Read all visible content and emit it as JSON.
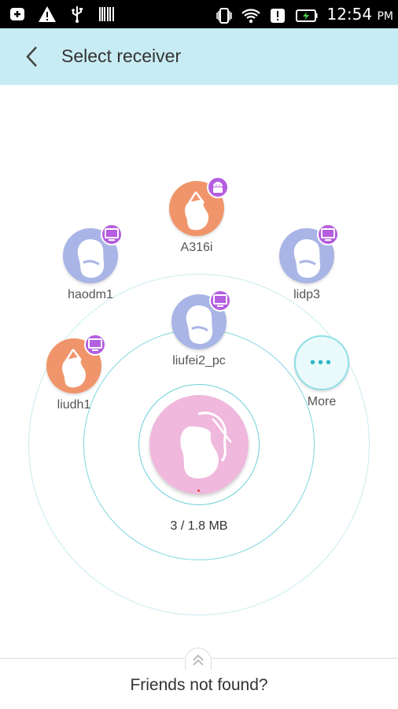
{
  "status_bar": {
    "time": "12:54",
    "ampm": "PM",
    "left_icons": [
      "add-box-icon",
      "warning-icon",
      "usb-icon",
      "barcode-icon"
    ],
    "right_icons": [
      "vibrate-icon",
      "wifi-icon",
      "alert-icon",
      "battery-charging-icon"
    ]
  },
  "app_bar": {
    "title": "Select receiver",
    "back_icon": "chevron-left-icon"
  },
  "devices": [
    {
      "label": "A316i",
      "type": "android",
      "color": "#f0956b"
    },
    {
      "label": "haodm1",
      "type": "pc",
      "color": "#a9b5e6"
    },
    {
      "label": "lidp3",
      "type": "pc",
      "color": "#a9b5e6"
    },
    {
      "label": "liufei2_pc",
      "type": "pc",
      "color": "#a9b5e6"
    },
    {
      "label": "liudh1",
      "type": "pc",
      "color": "#f0956b"
    }
  ],
  "more": {
    "label": "More",
    "icon": "more-dots-icon"
  },
  "center": {
    "transfer_count": "3 / 1.8 MB",
    "color": "#efb8dc"
  },
  "bottom": {
    "link_text": "Friends not found?",
    "handle_icon": "double-chevron-up-icon"
  },
  "colors": {
    "accent": "#c8ecf3",
    "badge": "#b45ee0",
    "ring": "#7fd6df"
  }
}
